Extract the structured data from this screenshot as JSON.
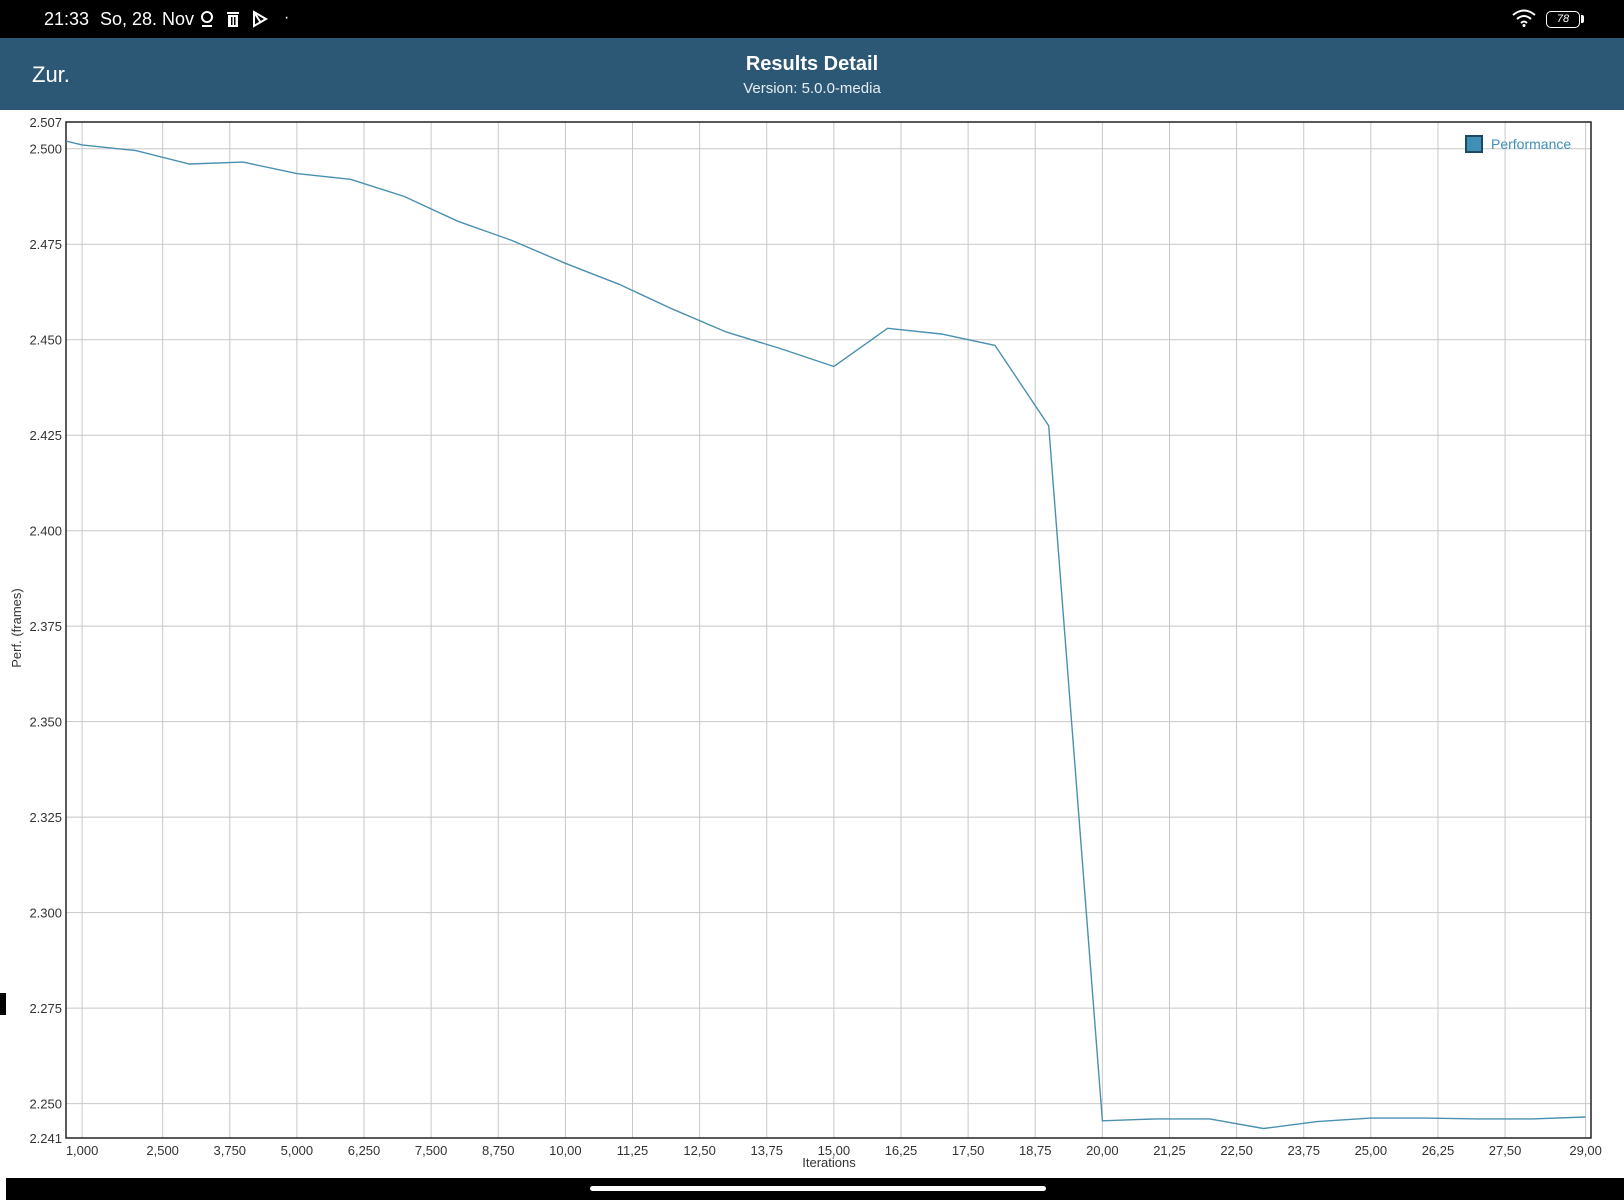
{
  "status_bar": {
    "time": "21:33",
    "date": "So, 28. Nov",
    "dot": "·",
    "battery": "78",
    "icons": [
      "location-icon",
      "trash-icon",
      "play-store-icon",
      "wifi-icon",
      "battery-icon"
    ]
  },
  "header": {
    "back_label": "Zur.",
    "title": "Results Detail",
    "subtitle": "Version: 5.0.0-media"
  },
  "colors": {
    "header_bg": "#2c5875",
    "line": "#4a90b0",
    "grid": "#c8c8c8",
    "legend_box": "#3f8fb7"
  },
  "chart_data": {
    "type": "line",
    "xlabel": "Iterations",
    "ylabel": "Perf. (frames)",
    "xlim": [
      0.7,
      29.1
    ],
    "ylim": [
      2.241,
      2.507
    ],
    "x_ticks": [
      1,
      2.5,
      3.75,
      5,
      6.25,
      7.5,
      8.75,
      10,
      11.25,
      12.5,
      13.75,
      15,
      16.25,
      17.5,
      18.75,
      20,
      21.25,
      22.5,
      23.75,
      25,
      26.25,
      27.5,
      29
    ],
    "x_tick_labels": [
      "1,000",
      "2,500",
      "3,750",
      "5,000",
      "6,250",
      "7,500",
      "8,750",
      "10,00",
      "11,25",
      "12,50",
      "13,75",
      "15,00",
      "16,25",
      "17,50",
      "18,75",
      "20,00",
      "21,25",
      "22,50",
      "23,75",
      "25,00",
      "26,25",
      "27,50",
      "29,00"
    ],
    "y_ticks": [
      2.241,
      2.25,
      2.275,
      2.3,
      2.325,
      2.35,
      2.375,
      2.4,
      2.425,
      2.45,
      2.475,
      2.5,
      2.507
    ],
    "y_tick_labels": [
      "2.241",
      "2.250",
      "2.275",
      "2.300",
      "2.325",
      "2.350",
      "2.375",
      "2.400",
      "2.425",
      "2.450",
      "2.475",
      "2.500",
      "2.507"
    ],
    "grid": true,
    "legend_position": "top-right",
    "series": [
      {
        "name": "Performance",
        "x": [
          0.7,
          1.0,
          2.0,
          3.0,
          4.0,
          5.0,
          6.0,
          7.0,
          8.0,
          9.0,
          10.0,
          11.0,
          12.0,
          13.0,
          14.0,
          15.0,
          16.0,
          17.0,
          18.0,
          19.0,
          20.0,
          21.0,
          22.0,
          23.0,
          24.0,
          25.0,
          26.0,
          27.0,
          28.0,
          29.0
        ],
        "y": [
          2.502,
          2.501,
          2.4995,
          2.496,
          2.4965,
          2.4935,
          2.492,
          2.4875,
          2.481,
          2.476,
          2.47,
          2.4645,
          2.458,
          2.452,
          2.4477,
          2.443,
          2.453,
          2.4515,
          2.4485,
          2.4275,
          2.2455,
          2.246,
          2.246,
          2.2435,
          2.2453,
          2.2462,
          2.2462,
          2.246,
          2.246,
          2.2465
        ]
      }
    ]
  }
}
